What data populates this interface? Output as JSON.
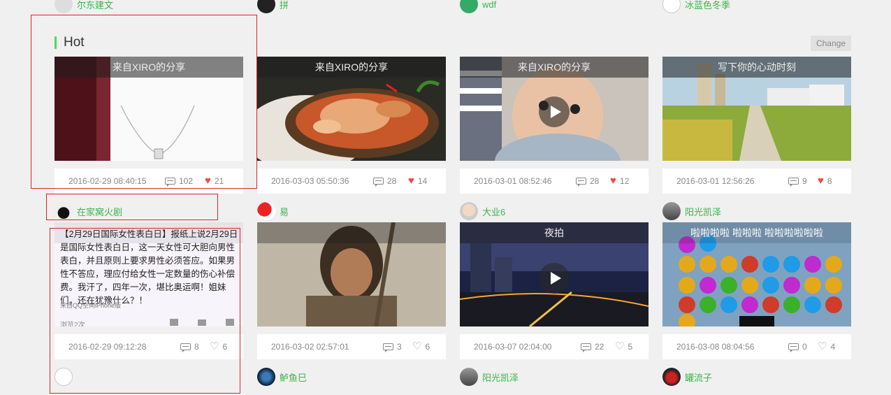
{
  "top_users": [
    {
      "name": "尔东建文",
      "avatar_icon": "user-avatar-icon"
    },
    {
      "name": "拼",
      "avatar_icon": "user-avatar-icon"
    },
    {
      "name": "wdf",
      "avatar_icon": "user-avatar-icon"
    },
    {
      "name": "冰蓝色冬季",
      "avatar_icon": "broken-image-icon"
    }
  ],
  "section": {
    "title": "Hot",
    "change_label": "Change"
  },
  "row1": [
    {
      "overlay": "来自XIRO的分享",
      "date": "2016-02-29 08:40:15",
      "comments": "102",
      "likes": "21",
      "liked": true,
      "video": false
    },
    {
      "overlay": "来自XIRO的分享",
      "date": "2016-03-03 05:50:36",
      "comments": "28",
      "likes": "14",
      "liked": true,
      "video": false
    },
    {
      "overlay": "来自XIRO的分享",
      "date": "2016-03-01 08:52:46",
      "comments": "28",
      "likes": "12",
      "liked": true,
      "video": true
    },
    {
      "overlay": "写下你的心动时刻",
      "date": "2016-03-01 12:56:26",
      "comments": "9",
      "likes": "8",
      "liked": true,
      "video": false
    }
  ],
  "row2_users": [
    {
      "name": "在家窝火剧"
    },
    {
      "name": "易"
    },
    {
      "name": "大业6"
    },
    {
      "name": "阳光凯泽"
    }
  ],
  "row2": [
    {
      "overlay": "",
      "date": "2016-02-29 09:12:28",
      "comments": "8",
      "likes": "6",
      "liked": false,
      "video": false
    },
    {
      "overlay": "",
      "date": "2016-03-02 02:57:01",
      "comments": "3",
      "likes": "6",
      "liked": false,
      "video": false
    },
    {
      "overlay": "夜拍",
      "date": "2016-03-07 02:04:00",
      "comments": "22",
      "likes": "5",
      "liked": false,
      "video": true
    },
    {
      "overlay": "啦啦啦啦  啦啦啦  啦啦啦啦啦啦",
      "date": "2016-03-08 08:04:56",
      "comments": "0",
      "likes": "4",
      "liked": false,
      "video": false
    }
  ],
  "text_post": {
    "body": "【2月29日国际女性表白日】报纸上说2月29日是国际女性表白日，这一天女性可大胆向男性表白，并且原则上要求男性必须答应。如果男性不答应，理应付给女性一定数量的伤心补偿费。我汗了，四年一次，堪比奥运啊！姐妹们，还在犹豫什么？！",
    "source": "来自QQ空间iPhone版",
    "views": "浏览2次"
  },
  "row3_users": [
    {
      "name": ""
    },
    {
      "name": "鲈鱼巳"
    },
    {
      "name": "阳光凯泽"
    },
    {
      "name": "罐流子"
    }
  ]
}
